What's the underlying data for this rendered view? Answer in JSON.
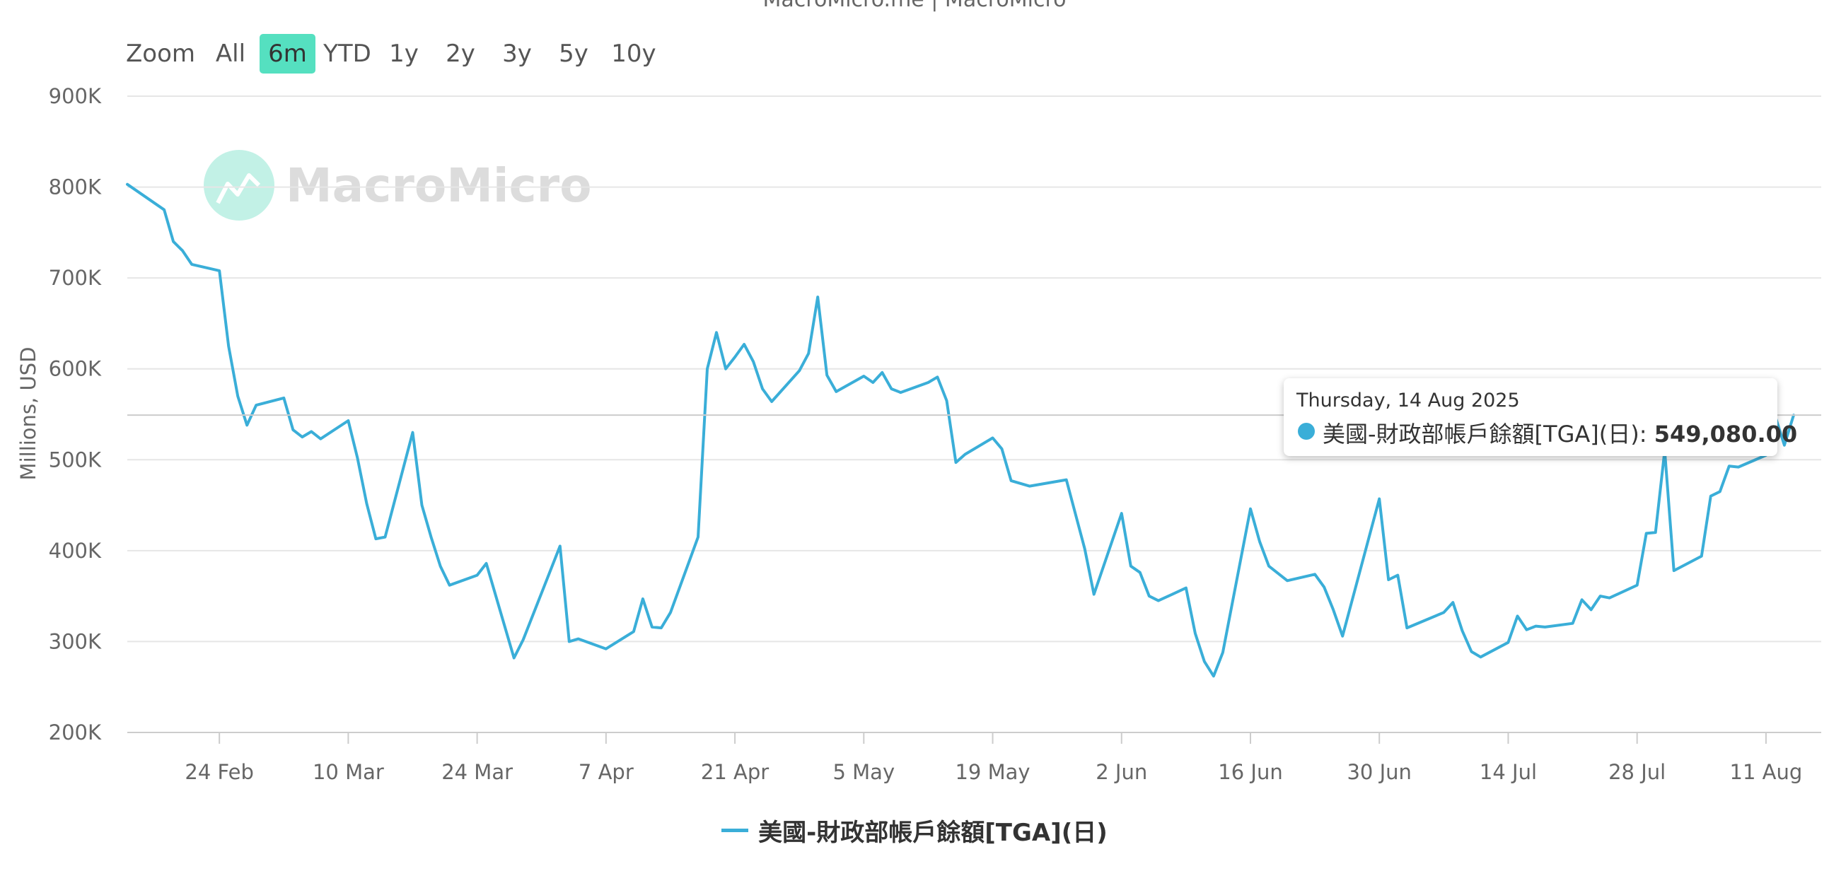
{
  "credits": "MacroMicro.me | MacroMicro",
  "range_selector": {
    "zoom_label": "Zoom",
    "buttons": [
      "All",
      "6m",
      "YTD",
      "1y",
      "2y",
      "3y",
      "5y",
      "10y"
    ],
    "selected": "6m"
  },
  "watermark": "MacroMicro",
  "tooltip": {
    "date": "Thursday, 14 Aug 2025",
    "series": "美國-財政部帳戶餘額[TGA](日)",
    "value": "549,080.00"
  },
  "colors": {
    "series": "#3aaed8",
    "range_active": "#55e0c0",
    "watermark": "#4fd6b6",
    "grid": "#e6e6e6"
  },
  "chart_data": {
    "type": "line",
    "title": "",
    "xlabel": "",
    "ylabel": "Millions, USD",
    "ylim": [
      200000,
      900000
    ],
    "yticks": [
      200000,
      300000,
      400000,
      500000,
      600000,
      700000,
      800000,
      900000
    ],
    "ytick_labels": [
      "200K",
      "300K",
      "400K",
      "500K",
      "600K",
      "700K",
      "800K",
      "900K"
    ],
    "xlim": [
      "2025-02-14",
      "2025-08-17"
    ],
    "xticks": [
      "2025-02-24",
      "2025-03-10",
      "2025-03-24",
      "2025-04-07",
      "2025-04-21",
      "2025-05-05",
      "2025-05-19",
      "2025-06-02",
      "2025-06-16",
      "2025-06-30",
      "2025-07-14",
      "2025-07-28",
      "2025-08-11"
    ],
    "xtick_labels": [
      "24 Feb",
      "10 Mar",
      "24 Mar",
      "7 Apr",
      "21 Apr",
      "5 May",
      "19 May",
      "2 Jun",
      "16 Jun",
      "30 Jun",
      "14 Jul",
      "28 Jul",
      "11 Aug"
    ],
    "grid": true,
    "legend": "bottom",
    "series": [
      {
        "name": "美國-財政部帳戶餘額[TGA](日)",
        "points": [
          [
            "2025-02-14",
            803000
          ],
          [
            "2025-02-18",
            775000
          ],
          [
            "2025-02-19",
            740000
          ],
          [
            "2025-02-20",
            730000
          ],
          [
            "2025-02-21",
            715000
          ],
          [
            "2025-02-24",
            708000
          ],
          [
            "2025-02-25",
            625000
          ],
          [
            "2025-02-26",
            570000
          ],
          [
            "2025-02-27",
            538000
          ],
          [
            "2025-02-28",
            560000
          ],
          [
            "2025-03-03",
            568000
          ],
          [
            "2025-03-04",
            533000
          ],
          [
            "2025-03-05",
            525000
          ],
          [
            "2025-03-06",
            531000
          ],
          [
            "2025-03-07",
            523000
          ],
          [
            "2025-03-10",
            543000
          ],
          [
            "2025-03-11",
            502000
          ],
          [
            "2025-03-12",
            452000
          ],
          [
            "2025-03-13",
            413000
          ],
          [
            "2025-03-14",
            415000
          ],
          [
            "2025-03-17",
            530000
          ],
          [
            "2025-03-18",
            450000
          ],
          [
            "2025-03-19",
            415000
          ],
          [
            "2025-03-20",
            383000
          ],
          [
            "2025-03-21",
            362000
          ],
          [
            "2025-03-24",
            373000
          ],
          [
            "2025-03-25",
            386000
          ],
          [
            "2025-03-28",
            282000
          ],
          [
            "2025-03-29",
            302000
          ],
          [
            "2025-04-02",
            405000
          ],
          [
            "2025-04-03",
            300000
          ],
          [
            "2025-04-04",
            303000
          ],
          [
            "2025-04-07",
            292000
          ],
          [
            "2025-04-10",
            311000
          ],
          [
            "2025-04-11",
            347000
          ],
          [
            "2025-04-12",
            316000
          ],
          [
            "2025-04-13",
            315000
          ],
          [
            "2025-04-14",
            332000
          ],
          [
            "2025-04-17",
            415000
          ],
          [
            "2025-04-18",
            600000
          ],
          [
            "2025-04-19",
            640000
          ],
          [
            "2025-04-20",
            600000
          ],
          [
            "2025-04-21",
            613000
          ],
          [
            "2025-04-22",
            627000
          ],
          [
            "2025-04-23",
            608000
          ],
          [
            "2025-04-24",
            578000
          ],
          [
            "2025-04-25",
            564000
          ],
          [
            "2025-04-28",
            598000
          ],
          [
            "2025-04-29",
            617000
          ],
          [
            "2025-04-30",
            679000
          ],
          [
            "2025-05-01",
            593000
          ],
          [
            "2025-05-02",
            575000
          ],
          [
            "2025-05-05",
            592000
          ],
          [
            "2025-05-06",
            585000
          ],
          [
            "2025-05-07",
            596000
          ],
          [
            "2025-05-08",
            578000
          ],
          [
            "2025-05-09",
            574000
          ],
          [
            "2025-05-12",
            585000
          ],
          [
            "2025-05-13",
            591000
          ],
          [
            "2025-05-14",
            565000
          ],
          [
            "2025-05-15",
            497000
          ],
          [
            "2025-05-16",
            506000
          ],
          [
            "2025-05-19",
            524000
          ],
          [
            "2025-05-20",
            512000
          ],
          [
            "2025-05-21",
            477000
          ],
          [
            "2025-05-23",
            471000
          ],
          [
            "2025-05-27",
            478000
          ],
          [
            "2025-05-29",
            402000
          ],
          [
            "2025-05-30",
            352000
          ],
          [
            "2025-06-02",
            441000
          ],
          [
            "2025-06-03",
            383000
          ],
          [
            "2025-06-04",
            376000
          ],
          [
            "2025-06-05",
            350000
          ],
          [
            "2025-06-06",
            345000
          ],
          [
            "2025-06-09",
            359000
          ],
          [
            "2025-06-10",
            309000
          ],
          [
            "2025-06-11",
            278000
          ],
          [
            "2025-06-12",
            262000
          ],
          [
            "2025-06-13",
            288000
          ],
          [
            "2025-06-16",
            446000
          ],
          [
            "2025-06-17",
            410000
          ],
          [
            "2025-06-18",
            383000
          ],
          [
            "2025-06-20",
            367000
          ],
          [
            "2025-06-23",
            374000
          ],
          [
            "2025-06-24",
            360000
          ],
          [
            "2025-06-25",
            335000
          ],
          [
            "2025-06-26",
            306000
          ],
          [
            "2025-06-30",
            457000
          ],
          [
            "2025-07-01",
            368000
          ],
          [
            "2025-07-02",
            373000
          ],
          [
            "2025-07-03",
            315000
          ],
          [
            "2025-07-07",
            332000
          ],
          [
            "2025-07-08",
            343000
          ],
          [
            "2025-07-09",
            312000
          ],
          [
            "2025-07-10",
            289000
          ],
          [
            "2025-07-11",
            283000
          ],
          [
            "2025-07-14",
            299000
          ],
          [
            "2025-07-15",
            328000
          ],
          [
            "2025-07-16",
            313000
          ],
          [
            "2025-07-17",
            317000
          ],
          [
            "2025-07-18",
            316000
          ],
          [
            "2025-07-21",
            320000
          ],
          [
            "2025-07-22",
            346000
          ],
          [
            "2025-07-23",
            335000
          ],
          [
            "2025-07-24",
            350000
          ],
          [
            "2025-07-25",
            348000
          ],
          [
            "2025-07-28",
            362000
          ],
          [
            "2025-07-29",
            419000
          ],
          [
            "2025-07-30",
            420000
          ],
          [
            "2025-07-31",
            510000
          ],
          [
            "2025-08-01",
            378000
          ],
          [
            "2025-08-04",
            394000
          ],
          [
            "2025-08-05",
            460000
          ],
          [
            "2025-08-06",
            465000
          ],
          [
            "2025-08-07",
            493000
          ],
          [
            "2025-08-08",
            492000
          ],
          [
            "2025-08-11",
            505000
          ],
          [
            "2025-08-12",
            548000
          ],
          [
            "2025-08-13",
            516000
          ],
          [
            "2025-08-14",
            549080
          ]
        ]
      }
    ],
    "highlight": {
      "x": "2025-08-14",
      "y": 549080
    }
  }
}
